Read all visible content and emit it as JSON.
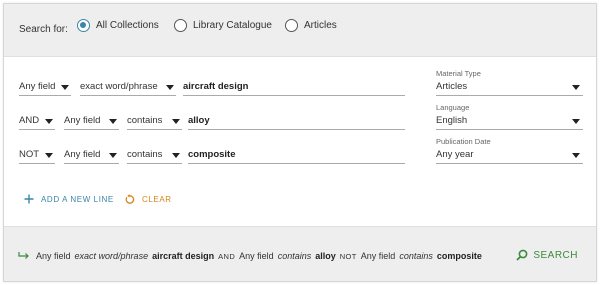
{
  "scope": {
    "label": "Search for:",
    "options": [
      {
        "label": "All Collections",
        "selected": true
      },
      {
        "label": "Library Catalogue",
        "selected": false
      },
      {
        "label": "Articles",
        "selected": false
      }
    ]
  },
  "query_rows": [
    {
      "operator": null,
      "field": "Any field",
      "match": "exact word/phrase",
      "term": "aircraft design"
    },
    {
      "operator": "AND",
      "field": "Any field",
      "match": "contains",
      "term": "alloy"
    },
    {
      "operator": "NOT",
      "field": "Any field",
      "match": "contains",
      "term": "composite"
    }
  ],
  "filters": [
    {
      "label": "Material Type",
      "value": "Articles"
    },
    {
      "label": "Language",
      "value": "English"
    },
    {
      "label": "Publication Date",
      "value": "Any year"
    }
  ],
  "actions": {
    "add_line": "ADD A NEW LINE",
    "clear": "CLEAR"
  },
  "summary": {
    "parts": [
      {
        "text": "Any field",
        "style": "plain"
      },
      {
        "text": "exact word/phrase",
        "style": "italic"
      },
      {
        "text": "aircraft design",
        "style": "bold"
      },
      {
        "text": "AND",
        "style": "op"
      },
      {
        "text": "Any field",
        "style": "plain"
      },
      {
        "text": "contains",
        "style": "italic"
      },
      {
        "text": "alloy",
        "style": "bold"
      },
      {
        "text": "NOT",
        "style": "op"
      },
      {
        "text": "Any field",
        "style": "plain"
      },
      {
        "text": "contains",
        "style": "italic"
      },
      {
        "text": "composite",
        "style": "bold"
      }
    ],
    "search_label": "SEARCH"
  },
  "colors": {
    "accent_blue": "#3a85a8",
    "clear_orange": "#d6851c",
    "search_green": "#3b8a3e",
    "panel_gray": "#eeeeee"
  }
}
